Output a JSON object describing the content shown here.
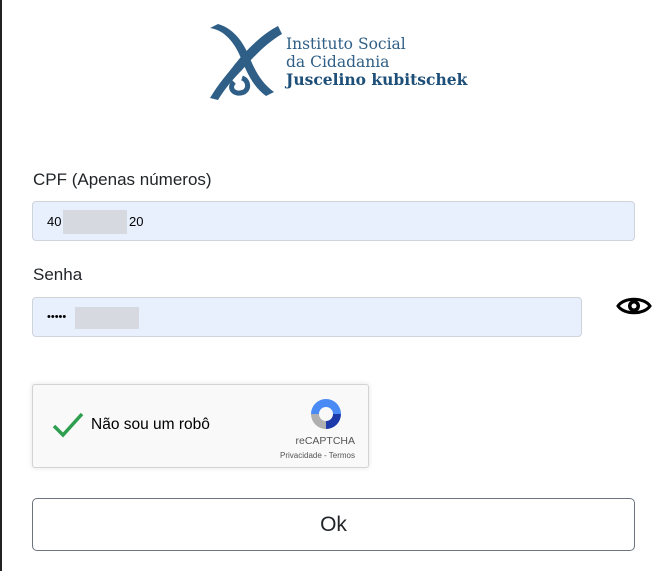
{
  "brand": {
    "line1": "Instituto Social",
    "line2": "da Cidadania",
    "line3": "Juscelino kubitschek",
    "color": "#2f5f86"
  },
  "form": {
    "cpf_label": "CPF (Apenas números)",
    "cpf_value_start": "40",
    "cpf_value_end": "20",
    "password_label": "Senha",
    "password_value": "•••••",
    "show_password_icon": "eye-icon",
    "submit_label": "Ok"
  },
  "captcha": {
    "label": "Não sou um robô",
    "brand": "reCAPTCHA",
    "links": "Privacidade - Termos",
    "checked": true
  },
  "colors": {
    "input_bg": "#e8f0fe",
    "check_green": "#2e9e4f",
    "recaptcha_blue": "#1c3aa9"
  }
}
